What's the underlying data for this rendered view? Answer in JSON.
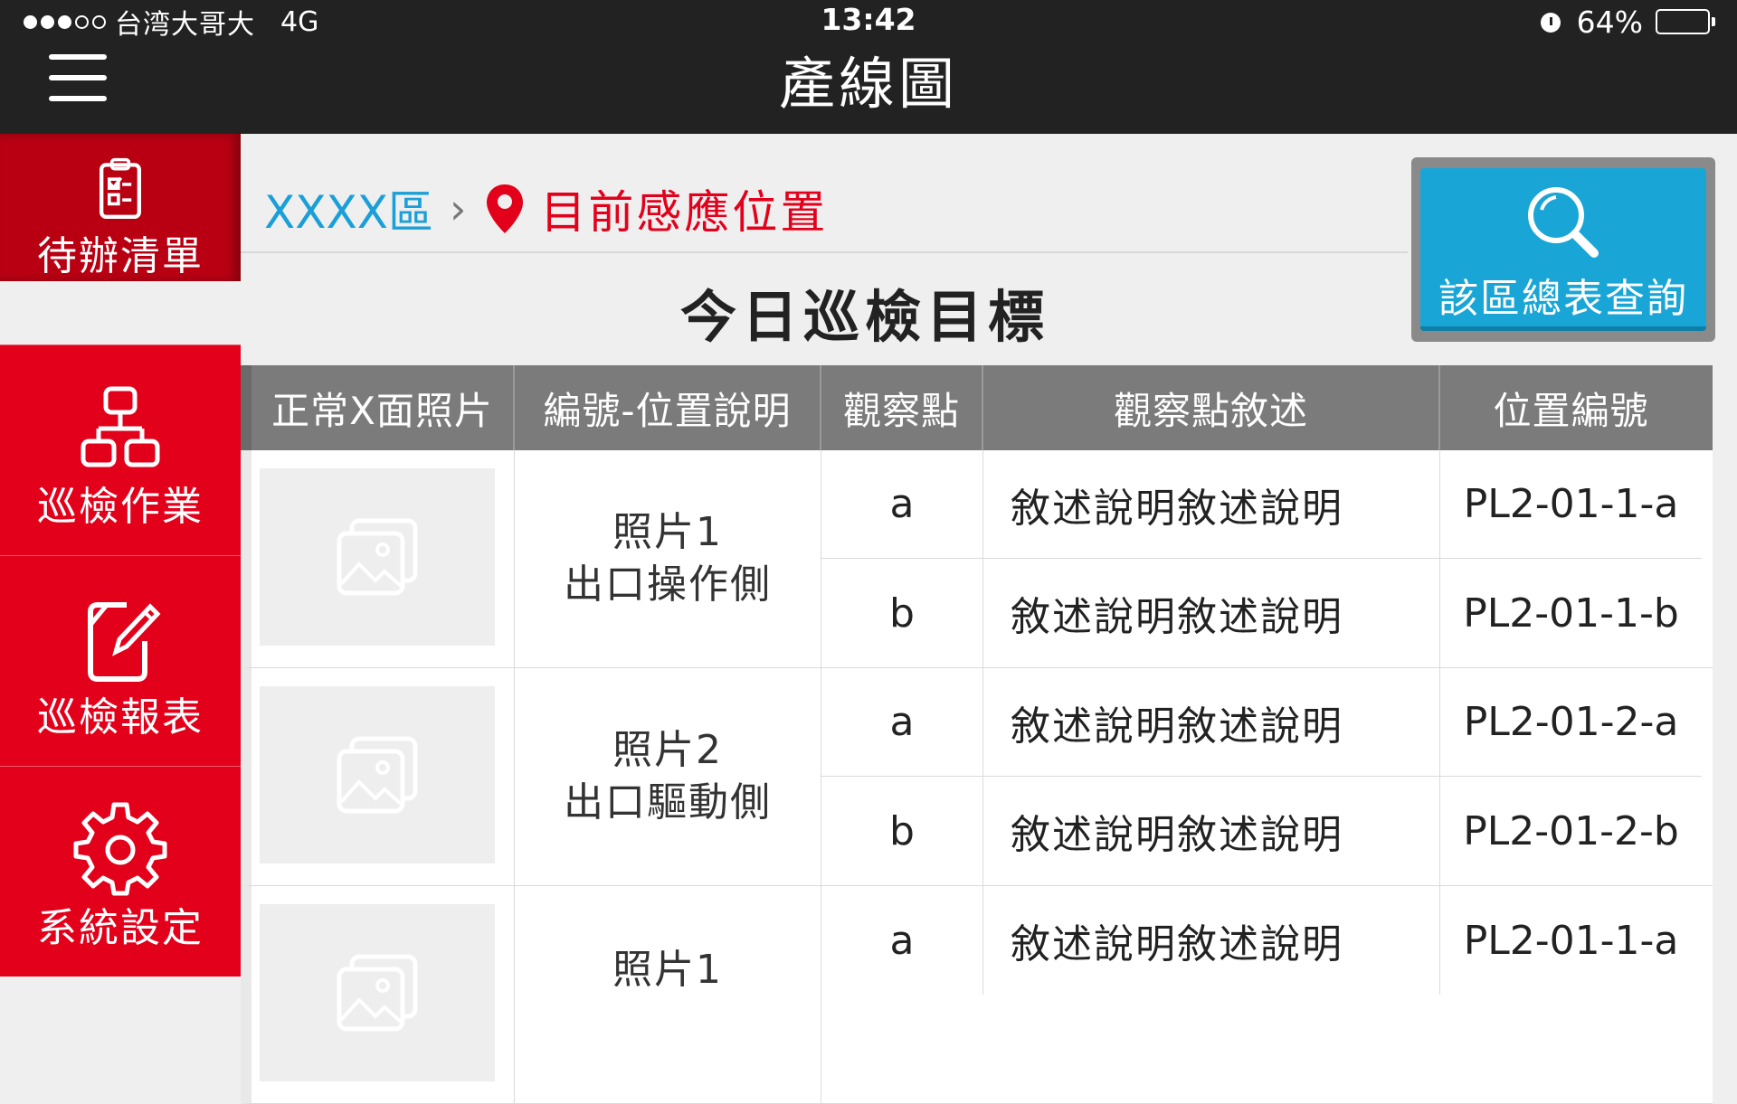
{
  "status_bar": {
    "signal_filled": 3,
    "signal_empty": 2,
    "carrier": "台湾大哥大",
    "network": "4G",
    "time": "13:42",
    "battery_percent": "64%",
    "battery_level": 0.64
  },
  "header": {
    "title": "產線圖",
    "menu_icon": "hamburger-menu-icon"
  },
  "sidebar": {
    "active_color": "#b80012",
    "item_color": "#e3001b",
    "items": [
      {
        "label": "待辦清單",
        "icon": "checklist-icon",
        "active": true
      },
      {
        "label": "巡檢作業",
        "icon": "hierarchy-icon",
        "active": false
      },
      {
        "label": "巡檢報表",
        "icon": "edit-document-icon",
        "active": false
      },
      {
        "label": "系統設定",
        "icon": "gear-icon",
        "active": false
      }
    ]
  },
  "breadcrumb": {
    "area": "XXXX區",
    "separator": "›",
    "current": "目前感應位置",
    "current_icon": "location-pin-icon",
    "area_color": "#1a9fd8",
    "current_color": "#e3001b"
  },
  "main": {
    "title": "今日巡檢目標"
  },
  "query_button": {
    "label": "該區總表查詢",
    "icon": "search-icon",
    "color": "#19a6d6"
  },
  "table": {
    "headers": [
      "正常X面照片",
      "編號-位置說明",
      "觀察點",
      "觀察點敘述",
      "位置編號"
    ],
    "groups": [
      {
        "photo_icon": "image-placeholder-icon",
        "location_line1": "照片1",
        "location_line2": "出口操作側",
        "rows": [
          {
            "point": "a",
            "description": "敘述說明敘述說明",
            "code": "PL2-01-1-a"
          },
          {
            "point": "b",
            "description": "敘述說明敘述說明",
            "code": "PL2-01-1-b"
          }
        ]
      },
      {
        "photo_icon": "image-placeholder-icon",
        "location_line1": "照片2",
        "location_line2": "出口驅動側",
        "rows": [
          {
            "point": "a",
            "description": "敘述說明敘述說明",
            "code": "PL2-01-2-a"
          },
          {
            "point": "b",
            "description": "敘述說明敘述說明",
            "code": "PL2-01-2-b"
          }
        ]
      },
      {
        "photo_icon": "image-placeholder-icon",
        "location_line1": "照片1",
        "location_line2": "",
        "rows": [
          {
            "point": "a",
            "description": "敘述說明敘述說明",
            "code": "PL2-01-1-a"
          }
        ]
      }
    ]
  }
}
